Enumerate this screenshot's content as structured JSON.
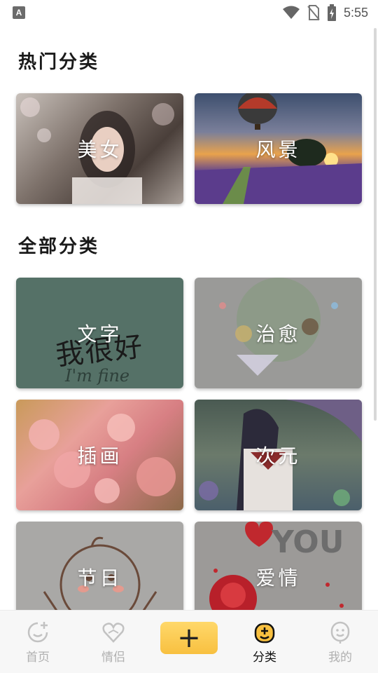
{
  "status_bar": {
    "app_badge": "A",
    "time": "5:55"
  },
  "sections": {
    "popular_title": "热门分类",
    "all_title": "全部分类"
  },
  "popular": [
    {
      "label": "美女"
    },
    {
      "label": "风景"
    }
  ],
  "all": [
    {
      "label": "文字",
      "art_text": "我很好",
      "art_subtext": "I'm fine"
    },
    {
      "label": "治愈"
    },
    {
      "label": "插画"
    },
    {
      "label": "次元"
    },
    {
      "label": "节日"
    },
    {
      "label": "爱情",
      "art_text": "YOU"
    }
  ],
  "tabbar": {
    "home": "首页",
    "couple": "情侣",
    "add": "+",
    "category": "分类",
    "mine": "我的"
  },
  "colors": {
    "accent": "#f8c040",
    "tab_inactive": "#b0b0b0",
    "tab_active": "#111111"
  }
}
